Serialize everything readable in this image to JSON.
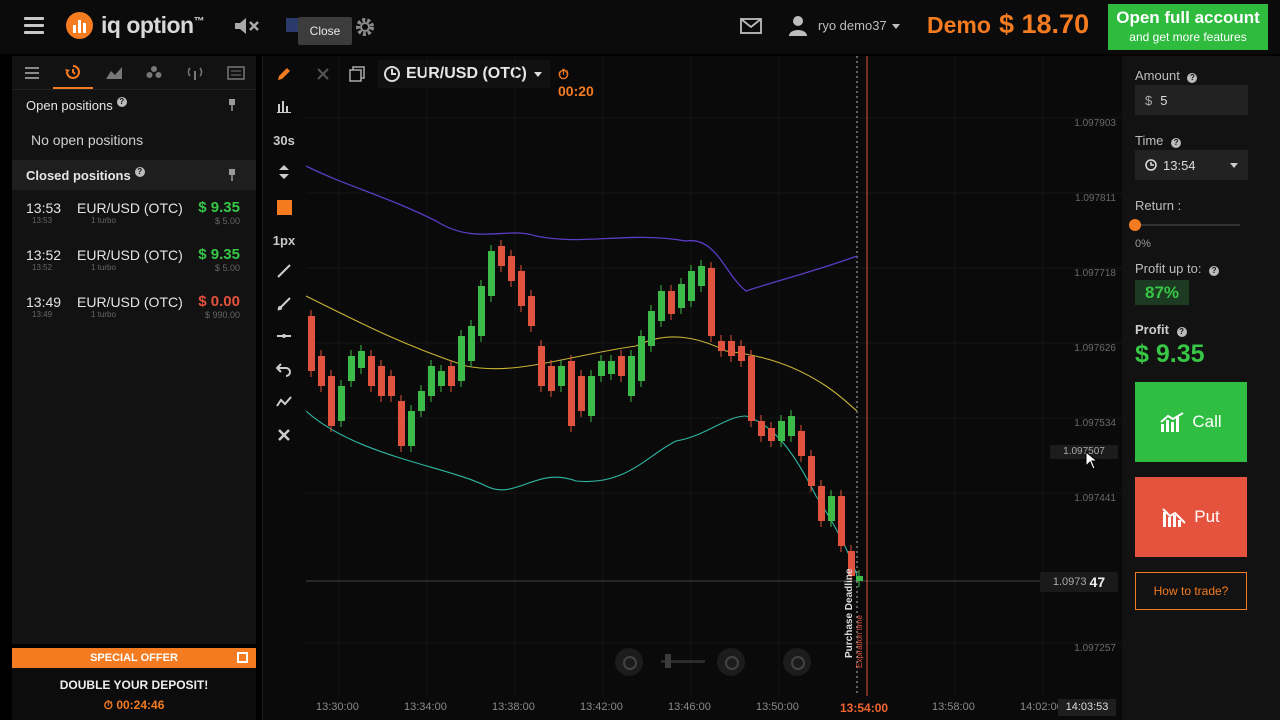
{
  "header": {
    "logo_text": "iq option",
    "logo_tm": "™",
    "close_tooltip": "Close",
    "username": "ryo demo37",
    "account_mode": "Demo",
    "balance": "$ 18.70",
    "open_account_title": "Open full account",
    "open_account_sub": "and get more features"
  },
  "left_panel": {
    "open_positions_title": "Open positions",
    "no_positions": "No open positions",
    "closed_positions_title": "Closed positions",
    "closed": [
      {
        "time": "13:53",
        "time_small": "13:53",
        "asset": "EUR/USD (OTC)",
        "type": "1 turbo",
        "profit": "$ 9.35",
        "invest": "$ 5.00",
        "status": "win"
      },
      {
        "time": "13:52",
        "time_small": "13:52",
        "asset": "EUR/USD (OTC)",
        "type": "1 turbo",
        "profit": "$ 9.35",
        "invest": "$ 5.00",
        "status": "win"
      },
      {
        "time": "13:49",
        "time_small": "13:49",
        "asset": "EUR/USD (OTC)",
        "type": "1 turbo",
        "profit": "$ 0.00",
        "invest": "$ 990.00",
        "status": "loss"
      }
    ],
    "special_offer": "SPECIAL OFFER",
    "deposit_text": "DOUBLE YOUR DEPOSIT!",
    "deposit_timer": "00:24:46"
  },
  "toolbar": {
    "period_label": "30s",
    "line_width_label": "1px"
  },
  "asset_bar": {
    "asset_name": "EUR/USD (OTC)",
    "countdown": "00:20"
  },
  "chart": {
    "price_labels": [
      "1.097903",
      "1.097811",
      "1.097718",
      "1.097626",
      "1.097534",
      "1.097441",
      "1.097257"
    ],
    "time_labels": [
      "13:30:00",
      "13:34:00",
      "13:38:00",
      "13:42:00",
      "13:46:00",
      "13:50:00",
      "13:58:00",
      "14:02:00"
    ],
    "hover_price": "1.097507",
    "current_price_prefix": "1.0973",
    "current_price_suffix": "47",
    "expiration_time": "13:54:00",
    "cursor_time": "14:03:53",
    "deadline_label": "Purchase Deadline",
    "expiration_label": "Expiration time"
  },
  "chart_data": {
    "type": "candlestick",
    "asset": "EUR/USD (OTC)",
    "x_range": [
      "13:30:00",
      "14:03:53"
    ],
    "y_ticks": [
      1.097903,
      1.097811,
      1.097718,
      1.097626,
      1.097534,
      1.097441,
      1.097257
    ],
    "current_price": 1.097347,
    "indicators": [
      "Bollinger Bands (upper)",
      "Moving Average",
      "Bollinger Bands (lower)"
    ],
    "colors": {
      "up": "#3dbb48",
      "down": "#e0533f",
      "upper_band": "#5b3cc4",
      "middle": "#c9b437",
      "lower_band": "#2fb7a3"
    }
  },
  "right_panel": {
    "amount_label": "Amount",
    "amount_currency": "$",
    "amount_value": "5",
    "time_label": "Time",
    "time_value": "13:54",
    "return_label": "Return :",
    "return_value": "0%",
    "return_fraction": 0,
    "profit_up_label": "Profit up to:",
    "profit_pct": "87%",
    "profit_label": "Profit",
    "profit_value": "$ 9.35",
    "call_label": "Call",
    "put_label": "Put",
    "how_label": "How to trade?"
  }
}
